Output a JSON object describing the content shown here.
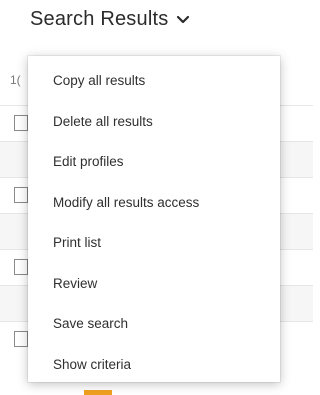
{
  "header": {
    "title": "Search Results",
    "dropdown_icon": "chevron-down-icon"
  },
  "results": {
    "count_fragment": "1("
  },
  "menu": {
    "items": [
      {
        "label": "Copy all results"
      },
      {
        "label": "Delete all results"
      },
      {
        "label": "Edit profiles"
      },
      {
        "label": "Modify all results access"
      },
      {
        "label": "Print list"
      },
      {
        "label": "Review"
      },
      {
        "label": "Save search"
      },
      {
        "label": "Show criteria"
      }
    ]
  },
  "colors": {
    "menu_background": "#ffffff",
    "alt_row": "#f6f6f6",
    "accent": "#f0a020"
  }
}
